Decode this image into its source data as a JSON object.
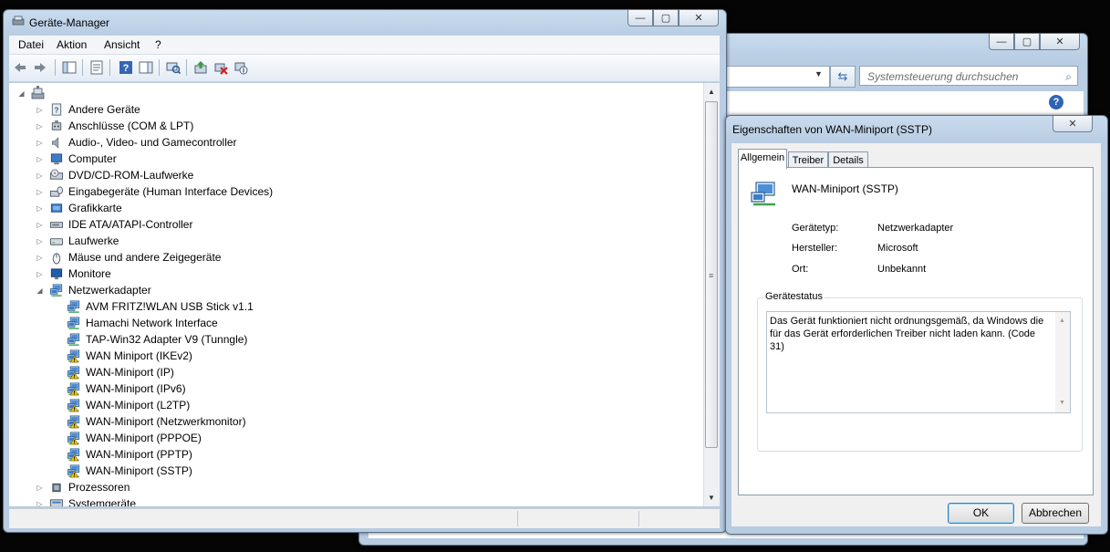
{
  "background_window": {
    "search_placeholder": "Systemsteuerung durchsuchen"
  },
  "device_manager": {
    "title": "Geräte-Manager",
    "menu": [
      "Datei",
      "Aktion",
      "Ansicht",
      "?"
    ],
    "toolbar_icons": [
      "back-icon",
      "forward-icon",
      "show-hide-tree-icon",
      "properties-icon",
      "help-icon",
      "action-pane-icon",
      "scan-hardware-icon",
      "update-driver-icon",
      "uninstall-icon",
      "disable-icon"
    ],
    "tree": [
      {
        "label": "Andere Geräte",
        "icon": "other-devices-icon",
        "level": 1,
        "expander": "collapsed"
      },
      {
        "label": "Anschlüsse (COM & LPT)",
        "icon": "port-icon",
        "level": 1,
        "expander": "collapsed"
      },
      {
        "label": "Audio-, Video- und Gamecontroller",
        "icon": "speaker-icon",
        "level": 1,
        "expander": "collapsed"
      },
      {
        "label": "Computer",
        "icon": "computer-icon",
        "level": 1,
        "expander": "collapsed"
      },
      {
        "label": "DVD/CD-ROM-Laufwerke",
        "icon": "dvd-drive-icon",
        "level": 1,
        "expander": "collapsed"
      },
      {
        "label": "Eingabegeräte (Human Interface Devices)",
        "icon": "hid-icon",
        "level": 1,
        "expander": "collapsed"
      },
      {
        "label": "Grafikkarte",
        "icon": "display-adapter-icon",
        "level": 1,
        "expander": "collapsed"
      },
      {
        "label": "IDE ATA/ATAPI-Controller",
        "icon": "ide-controller-icon",
        "level": 1,
        "expander": "collapsed"
      },
      {
        "label": "Laufwerke",
        "icon": "disk-drive-icon",
        "level": 1,
        "expander": "collapsed"
      },
      {
        "label": "Mäuse und andere Zeigegeräte",
        "icon": "mouse-icon",
        "level": 1,
        "expander": "collapsed"
      },
      {
        "label": "Monitore",
        "icon": "monitor-icon",
        "level": 1,
        "expander": "collapsed"
      },
      {
        "label": "Netzwerkadapter",
        "icon": "network-adapter-icon",
        "level": 1,
        "expander": "expanded"
      },
      {
        "label": "AVM FRITZ!WLAN USB Stick v1.1",
        "icon": "network-adapter-icon",
        "level": 2,
        "warning": false
      },
      {
        "label": "Hamachi Network Interface",
        "icon": "network-adapter-icon",
        "level": 2,
        "warning": false
      },
      {
        "label": "TAP-Win32 Adapter V9 (Tunngle)",
        "icon": "network-adapter-icon",
        "level": 2,
        "warning": false
      },
      {
        "label": "WAN Miniport (IKEv2)",
        "icon": "network-adapter-icon",
        "level": 2,
        "warning": true
      },
      {
        "label": "WAN-Miniport (IP)",
        "icon": "network-adapter-icon",
        "level": 2,
        "warning": true
      },
      {
        "label": "WAN-Miniport (IPv6)",
        "icon": "network-adapter-icon",
        "level": 2,
        "warning": true
      },
      {
        "label": "WAN-Miniport (L2TP)",
        "icon": "network-adapter-icon",
        "level": 2,
        "warning": true
      },
      {
        "label": "WAN-Miniport (Netzwerkmonitor)",
        "icon": "network-adapter-icon",
        "level": 2,
        "warning": true
      },
      {
        "label": "WAN-Miniport (PPPOE)",
        "icon": "network-adapter-icon",
        "level": 2,
        "warning": true
      },
      {
        "label": "WAN-Miniport (PPTP)",
        "icon": "network-adapter-icon",
        "level": 2,
        "warning": true
      },
      {
        "label": "WAN-Miniport (SSTP)",
        "icon": "network-adapter-icon",
        "level": 2,
        "warning": true
      },
      {
        "label": "Prozessoren",
        "icon": "processor-icon",
        "level": 1,
        "expander": "collapsed"
      },
      {
        "label": "Systemgeräte",
        "icon": "system-device-icon",
        "level": 1,
        "expander": "collapsed"
      }
    ]
  },
  "properties_dialog": {
    "title": "Eigenschaften von WAN-Miniport (SSTP)",
    "tabs": [
      "Allgemein",
      "Treiber",
      "Details"
    ],
    "active_tab": "Allgemein",
    "device_name": "WAN-Miniport (SSTP)",
    "fields": [
      {
        "key": "Gerätetyp:",
        "value": "Netzwerkadapter"
      },
      {
        "key": "Hersteller:",
        "value": "Microsoft"
      },
      {
        "key": "Ort:",
        "value": "Unbekannt"
      }
    ],
    "status_group_label": "Gerätestatus",
    "status_text": "Das Gerät funktioniert nicht ordnungsgemäß, da Windows die für das Gerät erforderlichen Treiber nicht laden kann. (Code 31)",
    "ok_label": "OK",
    "cancel_label": "Abbrechen"
  },
  "colors": {
    "accent": "#2f64b5",
    "warning": "#f2c200",
    "titlebar": "#c9dbee"
  }
}
